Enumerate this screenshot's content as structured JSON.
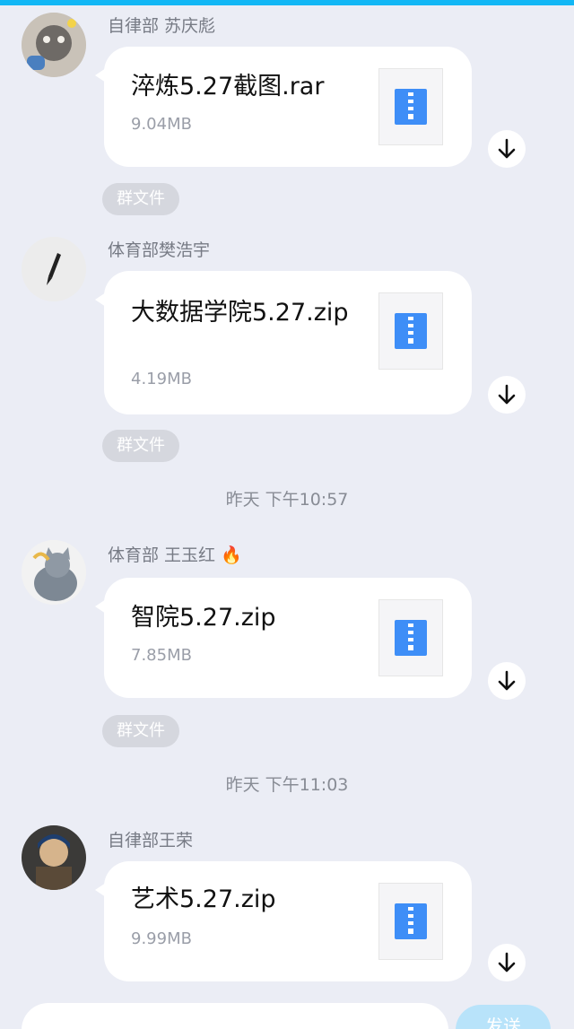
{
  "messages": [
    {
      "sender": "自律部 苏庆彪",
      "file_name": "淬炼5.27截图.rar",
      "file_size": "9.04MB",
      "tag": "群文件"
    },
    {
      "sender": "体育部樊浩宇",
      "file_name": "大数据学院5.27.zip",
      "file_size": "4.19MB",
      "tag": "群文件"
    },
    {
      "sender": "体育部 王玉红 🔥",
      "file_name": "智院5.27.zip",
      "file_size": "7.85MB",
      "tag": "群文件"
    },
    {
      "sender": "自律部王荣",
      "file_name": "艺术5.27.zip",
      "file_size": "9.99MB",
      "tag": ""
    }
  ],
  "timestamps": [
    "昨天 下午10:57",
    "昨天 下午11:03"
  ],
  "input": {
    "send_label": "发送"
  },
  "colors": {
    "accent": "#12b7f5",
    "background": "#ebedf5",
    "file_icon": "#3e8ef7"
  },
  "icons": {
    "file": "zip-file-icon",
    "download": "download-arrow-icon"
  }
}
